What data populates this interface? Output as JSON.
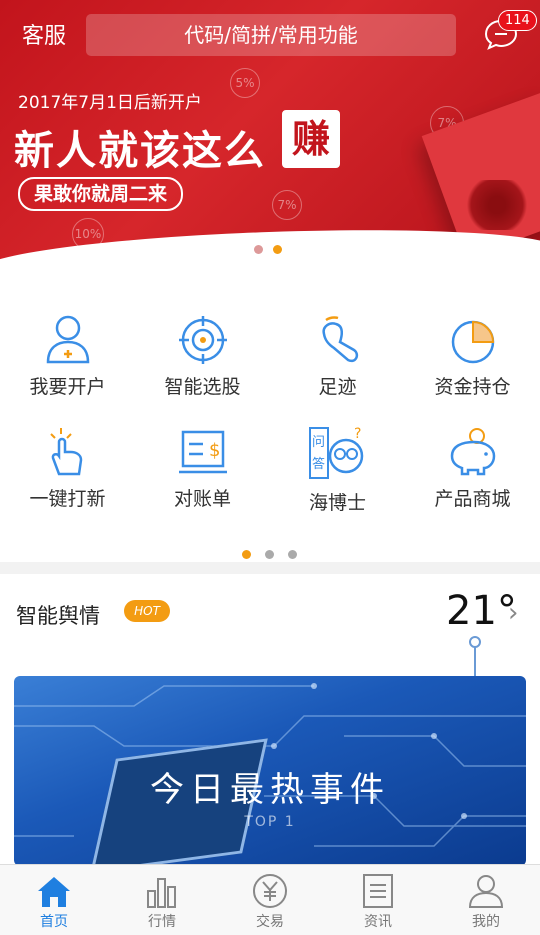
{
  "header": {
    "service_label": "客服",
    "search_placeholder": "代码/简拼/常用功能",
    "message_badge": "114"
  },
  "banner": {
    "date_text": "2017年7月1日后新开户",
    "title": "新人就该这么",
    "title_highlight": "赚",
    "subtitle": "果敢你就周二来",
    "coins": [
      "5%",
      "7%",
      "7%",
      "10%"
    ],
    "page_count": 2,
    "active_page": 1
  },
  "features": [
    {
      "label": "我要开户",
      "icon": "user-plus-icon"
    },
    {
      "label": "智能选股",
      "icon": "target-icon"
    },
    {
      "label": "足迹",
      "icon": "footprint-icon"
    },
    {
      "label": "资金持仓",
      "icon": "pie-chart-icon"
    },
    {
      "label": "一键打新",
      "icon": "tap-hand-icon"
    },
    {
      "label": "对账单",
      "icon": "statement-icon"
    },
    {
      "label": "海博士",
      "icon": "qa-doctor-icon"
    },
    {
      "label": "产品商城",
      "icon": "piggy-bank-icon"
    }
  ],
  "feature_pages": {
    "count": 3,
    "active": 0
  },
  "sentiment": {
    "title": "智能舆情",
    "hot_badge": "HOT",
    "temperature": "21°",
    "card_title": "今日最热事件",
    "card_sub": "TOP 1"
  },
  "tabs": [
    {
      "label": "首页",
      "icon": "home-icon",
      "active": true
    },
    {
      "label": "行情",
      "icon": "market-chart-icon",
      "active": false
    },
    {
      "label": "交易",
      "icon": "yuan-icon",
      "active": false
    },
    {
      "label": "资讯",
      "icon": "news-icon",
      "active": false
    },
    {
      "label": "我的",
      "icon": "profile-icon",
      "active": false
    }
  ],
  "colors": {
    "brand_red": "#c2141c",
    "accent_orange": "#f39c12",
    "tab_active": "#1f7fe0",
    "icon_blue": "#3a8ee6"
  }
}
